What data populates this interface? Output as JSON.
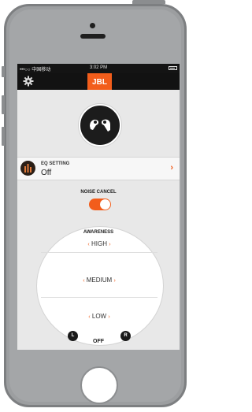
{
  "status_bar": {
    "carrier": "•••○○ 中国移动",
    "wifi": "wifi-icon",
    "time": "3:02 PM"
  },
  "app_bar": {
    "settings_icon": "gear-icon",
    "brand": "JBL",
    "brand_color": "#f25d1b"
  },
  "device": {
    "icon": "earbuds-icon"
  },
  "eq_setting": {
    "label": "EQ SETTING",
    "value": "Off",
    "chevron": "›"
  },
  "noise_cancel": {
    "label": "NOISE CANCEL",
    "enabled": true
  },
  "awareness": {
    "label": "AWARENESS",
    "levels": [
      "HIGH",
      "MEDIUM",
      "LOW"
    ],
    "off_label": "OFF",
    "left_label": "L",
    "right_label": "R",
    "arrow_left": "‹",
    "arrow_right": "›"
  }
}
